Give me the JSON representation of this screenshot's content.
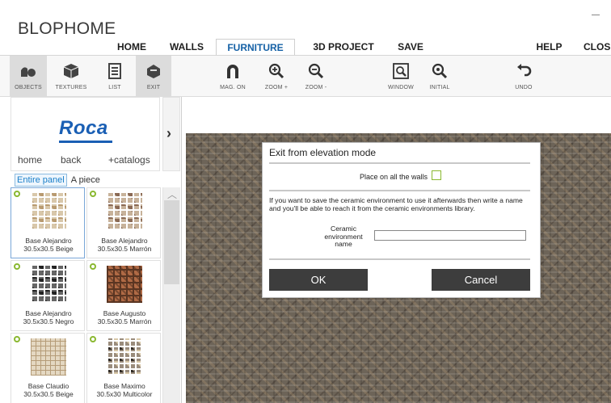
{
  "app": {
    "title": "BLOPHOME"
  },
  "menu": {
    "items": [
      {
        "label": "HOME"
      },
      {
        "label": "WALLS"
      },
      {
        "label": "FURNITURE",
        "active": true
      },
      {
        "label": "3D PROJECT"
      },
      {
        "label": "SAVE"
      },
      {
        "label": "HELP"
      },
      {
        "label": "CLOS"
      }
    ]
  },
  "toolbar": {
    "left_tools": [
      {
        "label": "OBJECTS",
        "icon": "objects-icon"
      },
      {
        "label": "TEXTURES",
        "icon": "cube-icon"
      },
      {
        "label": "LIST",
        "icon": "list-icon"
      },
      {
        "label": "EXIT",
        "icon": "exit-icon"
      }
    ],
    "tools": [
      {
        "label": "MAG. ON",
        "icon": "magnet-icon"
      },
      {
        "label": "ZOOM +",
        "icon": "zoom-in-icon"
      },
      {
        "label": "ZOOM -",
        "icon": "zoom-out-icon"
      },
      {
        "label": "WINDOW",
        "icon": "zoom-window-icon"
      },
      {
        "label": "INITIAL",
        "icon": "zoom-initial-icon"
      },
      {
        "label": "UNDO",
        "icon": "undo-icon"
      }
    ]
  },
  "catalog": {
    "brand": "Roca",
    "nav": {
      "home": "home",
      "back": "back",
      "catalogs": "+catalogs"
    },
    "tabs": {
      "entire": "Entire panel",
      "piece": "A piece"
    },
    "items": [
      {
        "name": "Base Alejandro 30.5x30.5 Beige",
        "line1": "Base Alejandro",
        "line2": "30.5x30.5 Beige"
      },
      {
        "name": "Base Alejandro 30.5x30.5 Marrón",
        "line1": "Base Alejandro",
        "line2": "30.5x30.5 Marrón"
      },
      {
        "name": "Base Alejandro 30.5x30.5 Negro",
        "line1": "Base Alejandro",
        "line2": "30.5x30.5 Negro"
      },
      {
        "name": "Base Augusto 30.5x30.5 Marrón",
        "line1": "Base Augusto",
        "line2": "30.5x30.5 Marrón"
      },
      {
        "name": "Base Claudio 30.5x30.5 Beige",
        "line1": "Base Claudio",
        "line2": "30.5x30.5 Beige"
      },
      {
        "name": "Base Maximo 30.5x30 Multicolor",
        "line1": "Base Maximo",
        "line2": "30.5x30 Multicolor"
      }
    ]
  },
  "dialog": {
    "title": "Exit from elevation mode",
    "place_label": "Place on all the walls",
    "info": "If you want to save the ceramic environment to use it afterwards then write a name and you'll be able to reach it from the ceramic environments library.",
    "env_label_1": "Ceramic",
    "env_label_2": "environment",
    "env_label_3": "name",
    "env_value": "",
    "ok_label": "OK",
    "cancel_label": "Cancel"
  }
}
